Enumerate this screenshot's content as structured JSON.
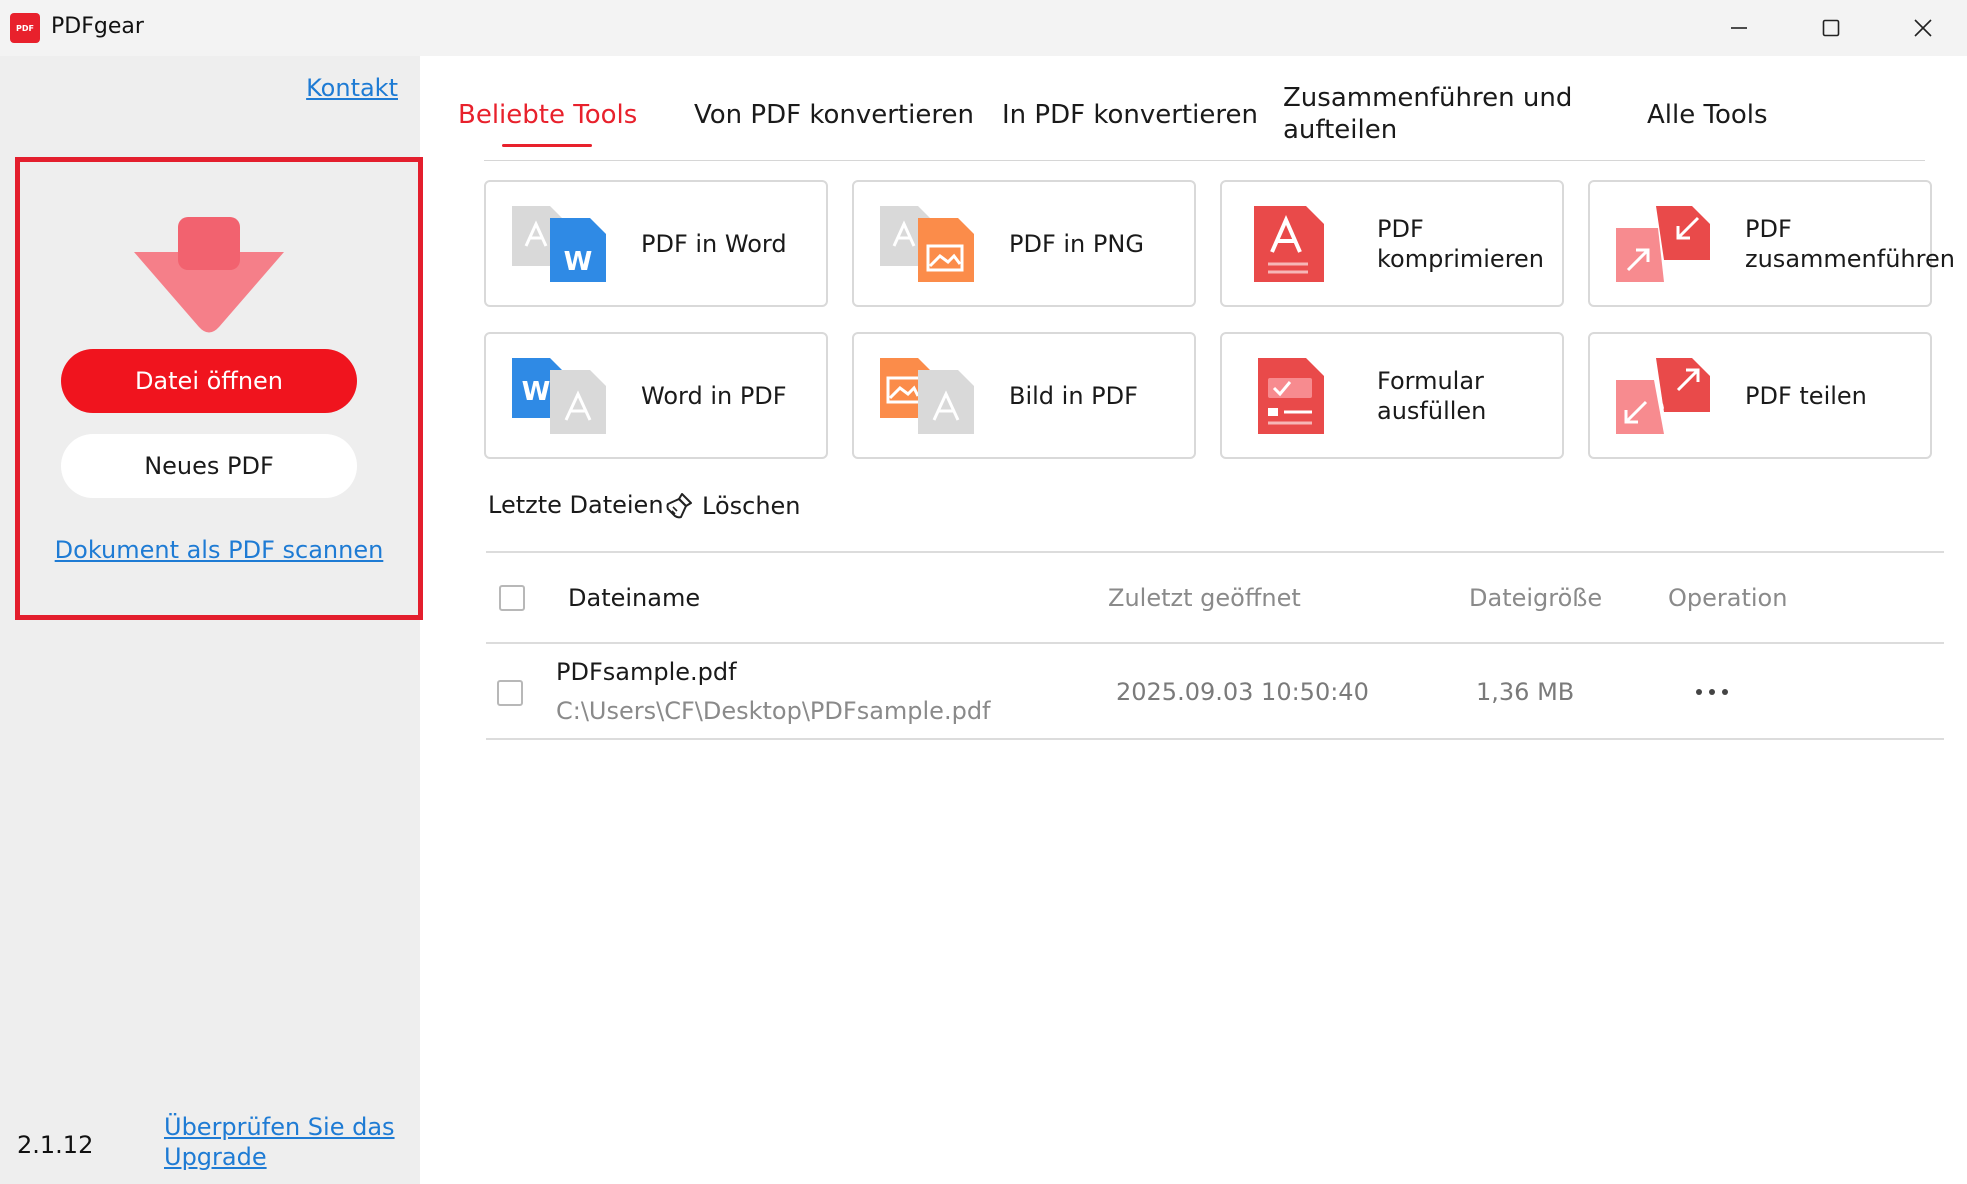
{
  "window": {
    "title": "PDFgear",
    "logo_text": "PDF",
    "controls": [
      "minimize-icon",
      "maximize-icon",
      "close-icon"
    ]
  },
  "sidebar": {
    "contact_link": "Kontakt",
    "open_file_button": "Datei öffnen",
    "new_pdf_button": "Neues PDF",
    "scan_link": "Dokument als PDF scannen",
    "version": "2.1.12",
    "upgrade_link": "Überprüfen Sie das Upgrade"
  },
  "tabs": [
    {
      "label": "Beliebte Tools",
      "active": true
    },
    {
      "label": "Von PDF konvertieren",
      "active": false
    },
    {
      "label": "In PDF konvertieren",
      "active": false
    },
    {
      "label": "Zusammenführen und aufteilen",
      "active": false
    },
    {
      "label": "Alle Tools",
      "active": false
    }
  ],
  "tools": [
    {
      "label": "PDF in Word",
      "icon": "pdf-to-word-icon"
    },
    {
      "label": "PDF in PNG",
      "icon": "pdf-to-png-icon"
    },
    {
      "label": "PDF komprimieren",
      "icon": "compress-pdf-icon"
    },
    {
      "label": "PDF zusammenführen",
      "icon": "merge-pdf-icon"
    },
    {
      "label": "Word in PDF",
      "icon": "word-to-pdf-icon"
    },
    {
      "label": "Bild in PDF",
      "icon": "image-to-pdf-icon"
    },
    {
      "label": "Formular ausfüllen",
      "icon": "fill-form-icon"
    },
    {
      "label": "PDF teilen",
      "icon": "split-pdf-icon"
    }
  ],
  "recent": {
    "title": "Letzte Dateien",
    "clear_label": "Löschen",
    "columns": {
      "name": "Dateiname",
      "opened": "Zuletzt geöffnet",
      "size": "Dateigröße",
      "operation": "Operation"
    },
    "files": [
      {
        "name": "PDFsample.pdf",
        "path": "C:\\Users\\CF\\Desktop\\PDFsample.pdf",
        "opened": "2025.09.03 10:50:40",
        "size": "1,36 MB"
      }
    ]
  },
  "colors": {
    "accent": "#e8212c",
    "button_red": "#f0141e",
    "link_blue": "#1e7bd4",
    "highlight_border": "#e31e2d",
    "sidebar_bg": "#eeeeee"
  }
}
